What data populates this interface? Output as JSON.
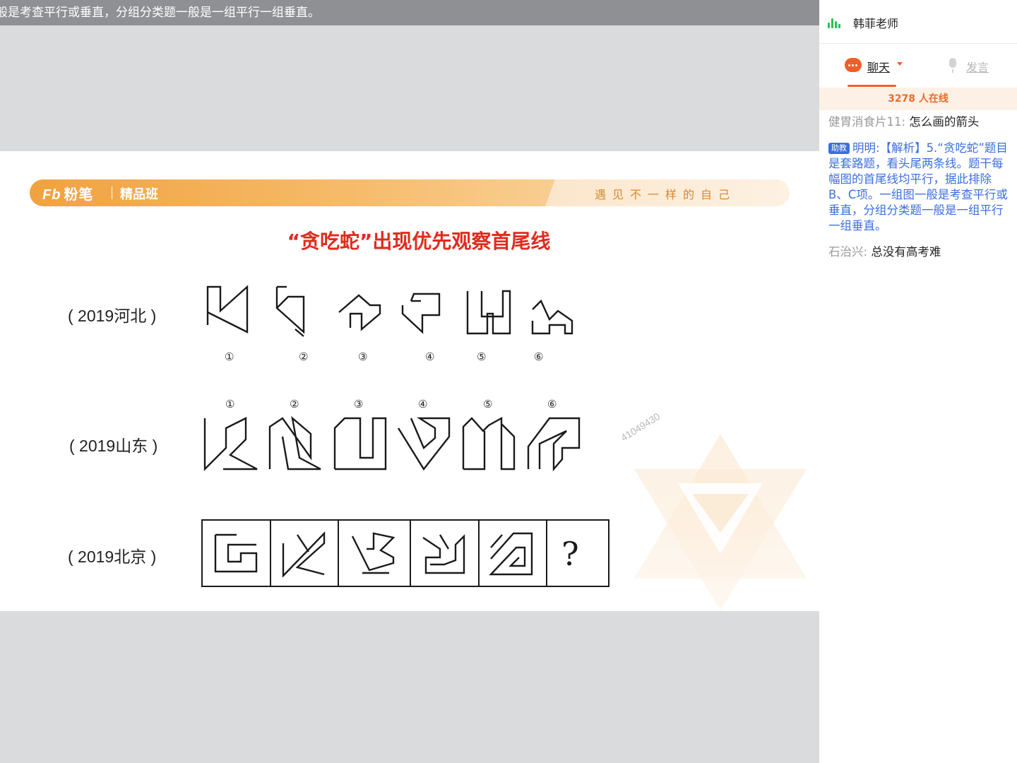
{
  "top_banner": {
    "text": "般是考查平行或垂直，分组分类题一般是一组平行一组垂直。"
  },
  "slide": {
    "logo": "粉笔",
    "logo_mark": "Fb",
    "course": "精品班",
    "slogan": "遇见不一样的自己",
    "title": "“贪吃蛇”出现优先观察首尾线",
    "rows": [
      {
        "label": "( 2019河北 )",
        "numbers": [
          "①",
          "②",
          "③",
          "④",
          "⑤",
          "⑥"
        ]
      },
      {
        "label": "( 2019山东 )",
        "numbers": [
          "①",
          "②",
          "③",
          "④",
          "⑤",
          "⑥"
        ]
      },
      {
        "label": "( 2019北京 )",
        "question": "?"
      }
    ],
    "watermark_id": "41049430"
  },
  "panel": {
    "teacher_name": "韩菲老师",
    "tabs": {
      "chat": "聊天",
      "speak": "发言"
    },
    "online": "3278 人在线",
    "messages": [
      {
        "sender": "健胃消食片11:",
        "text": "怎么画的箭头",
        "role": "student"
      },
      {
        "badge": "助教",
        "sender": "明明:",
        "text": "【解析】5.“贪吃蛇”题目是套路题，看头尾两条线。题干每幅图的首尾线均平行，据此排除B、C项。一组图一般是考查平行或垂直，分组分类题一般是一组平行一组垂直。",
        "role": "assistant"
      },
      {
        "sender": "石治兴:",
        "text": "总没有高考难",
        "role": "student"
      }
    ]
  },
  "colors": {
    "accent": "#ee5f2b",
    "title_red": "#e02b1f",
    "header_orange": "#f1a23f",
    "ta_blue": "#3b6fe0",
    "audio_green": "#2bbf5a"
  },
  "icons": [
    "audio-level-icon",
    "chat-bubble-icon",
    "caret-down-icon",
    "microphone-icon"
  ]
}
